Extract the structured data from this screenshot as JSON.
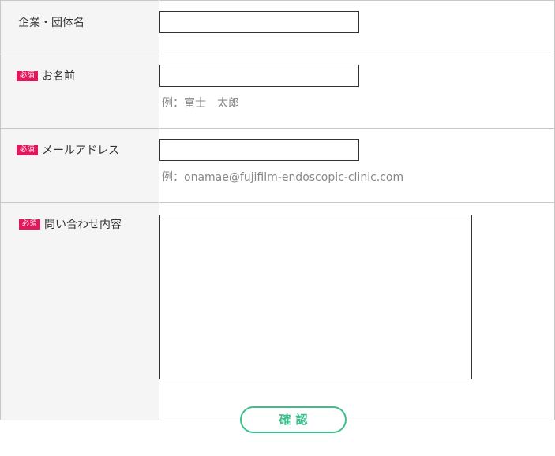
{
  "form": {
    "required_badge": "必須",
    "company": {
      "label": "企業・団体名",
      "value": ""
    },
    "name": {
      "label": "お名前",
      "value": "",
      "example": "例：富士　太郎"
    },
    "email": {
      "label": "メールアドレス",
      "value": "",
      "example": "例：onamae@fujifilm-endoscopic-clinic.com"
    },
    "message": {
      "label": "問い合わせ内容",
      "value": ""
    }
  },
  "actions": {
    "confirm_label": "確認"
  },
  "colors": {
    "badge": "#e2185b",
    "button_accent": "#3dbf8c",
    "label_bg": "#f5f5f5"
  }
}
